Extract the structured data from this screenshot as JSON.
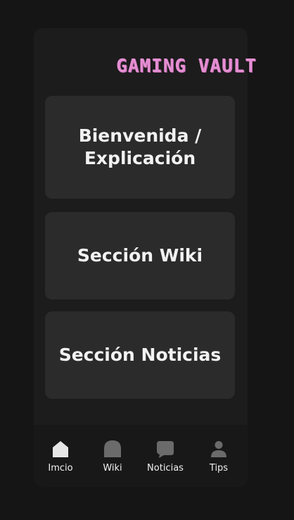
{
  "app": {
    "title": "GAMING VAULT"
  },
  "cards": [
    {
      "label": "Bienvenida /\nExplicación"
    },
    {
      "label": "Sección Wiki"
    },
    {
      "label": "Sección Noticias"
    }
  ],
  "tabs": [
    {
      "label": "Imcio",
      "icon": "home-icon"
    },
    {
      "label": "Wiki",
      "icon": "book-icon"
    },
    {
      "label": "Noticias",
      "icon": "chat-icon"
    },
    {
      "label": "Tips",
      "icon": "user-icon"
    }
  ],
  "colors": {
    "background": "#151515",
    "surface": "#1c1c1c",
    "card": "#2b2b2b",
    "title_accent": "#e48fd3",
    "icon_active": "#e6e6e6",
    "icon_inactive": "#6b6b6b"
  }
}
